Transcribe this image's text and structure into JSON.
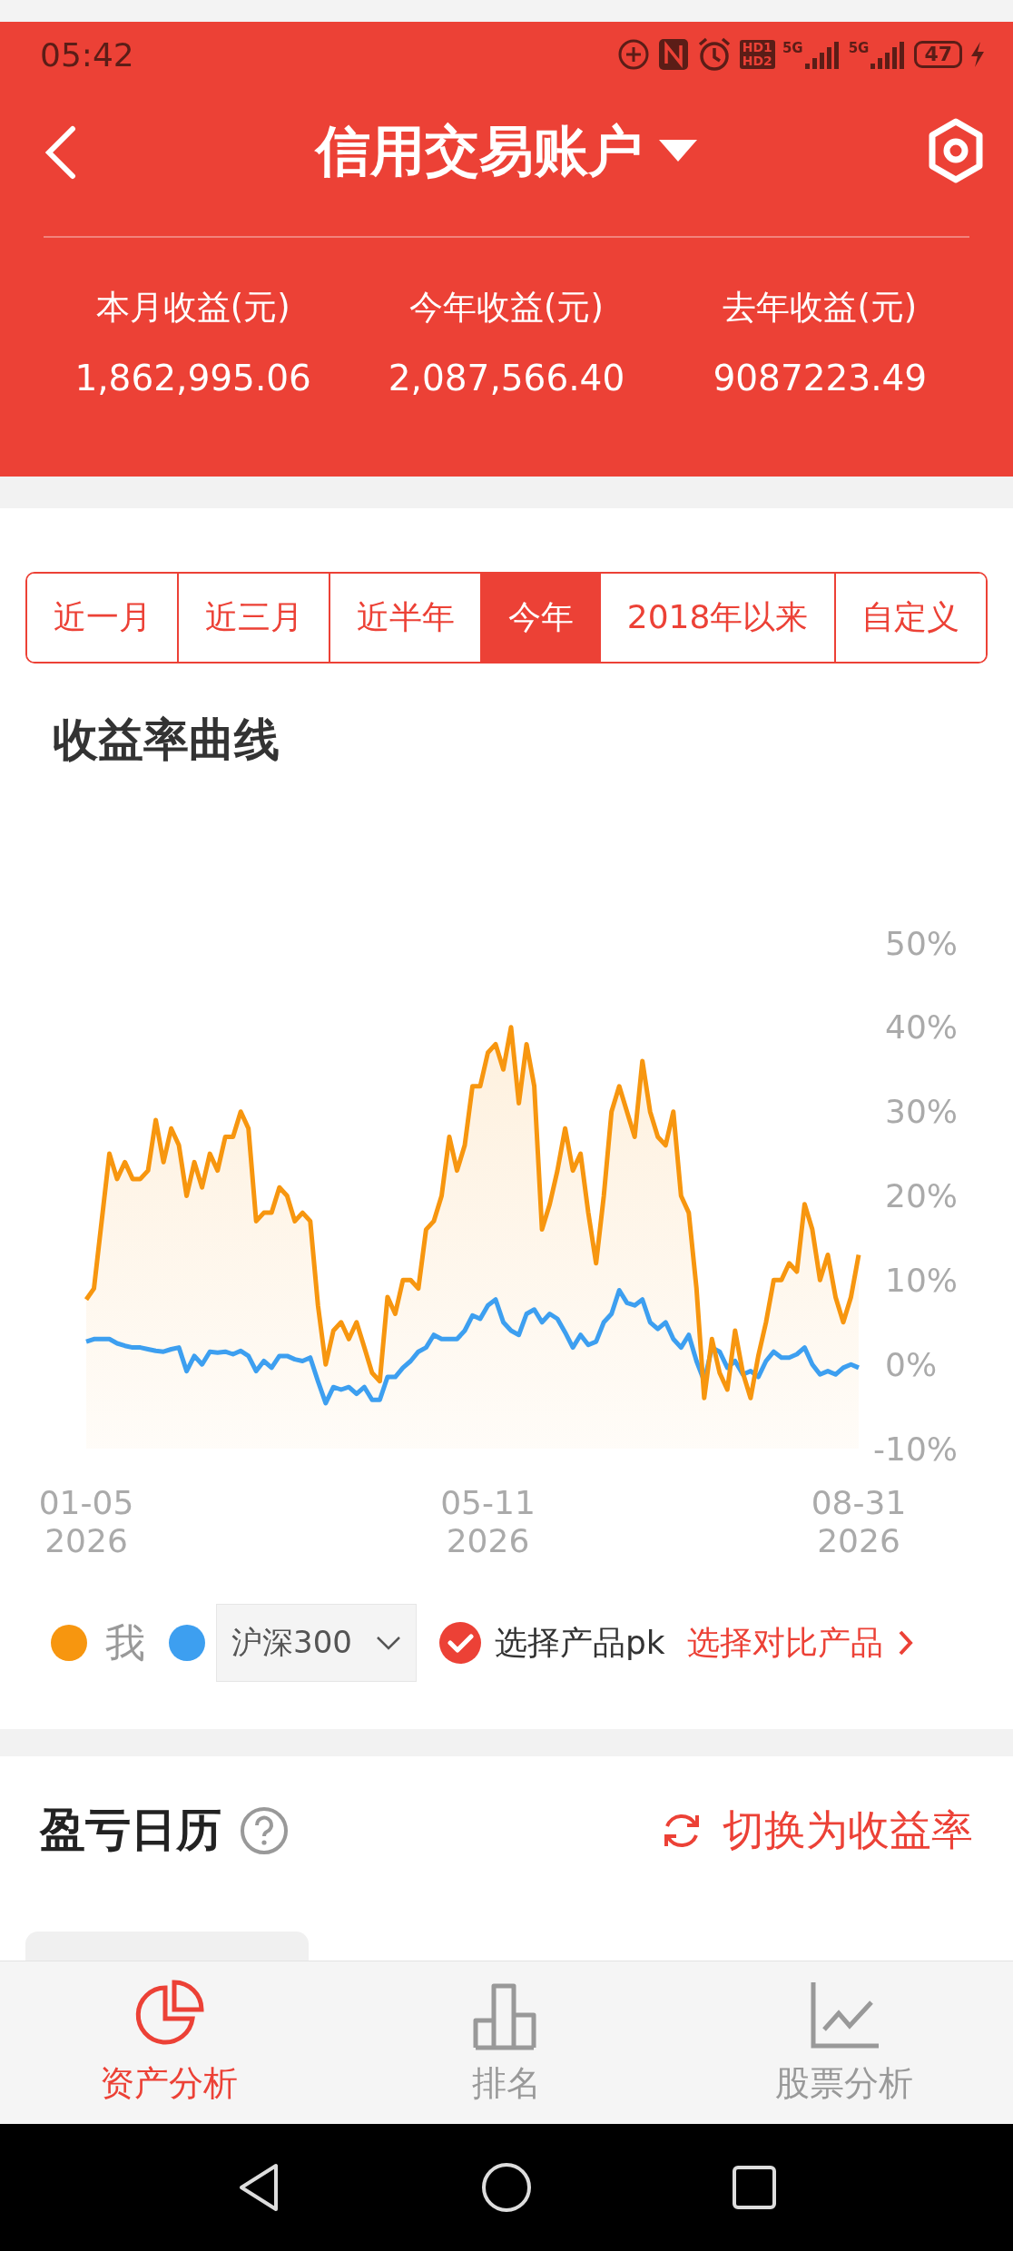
{
  "status_bar": {
    "time": "05:42",
    "hd": [
      "HD1",
      "HD2"
    ],
    "network": [
      "5G",
      "5G"
    ],
    "battery": "47"
  },
  "header": {
    "title": "信用交易账户",
    "stats": [
      {
        "label": "本月收益(元)",
        "value": "1,862,995.06"
      },
      {
        "label": "今年收益(元)",
        "value": "2,087,566.40"
      },
      {
        "label": "去年收益(元)",
        "value": "9087223.49"
      }
    ]
  },
  "period_tabs": [
    {
      "label": "近一月",
      "selected": false
    },
    {
      "label": "近三月",
      "selected": false
    },
    {
      "label": "近半年",
      "selected": false
    },
    {
      "label": "今年",
      "selected": true
    },
    {
      "label": "2018年以来",
      "selected": false
    },
    {
      "label": "自定义",
      "selected": false
    }
  ],
  "return_chart": {
    "title": "收益率曲线",
    "chart_data": {
      "type": "line",
      "categories": [
        "01-05\n2026",
        null,
        null,
        null,
        null,
        null,
        null,
        null,
        null,
        null,
        null,
        null,
        null,
        null,
        null,
        null,
        null,
        null,
        null,
        null,
        null,
        null,
        null,
        null,
        null,
        null,
        null,
        null,
        null,
        null,
        null,
        null,
        null,
        null,
        null,
        null,
        null,
        null,
        null,
        null,
        null,
        null,
        null,
        null,
        null,
        null,
        null,
        null,
        null,
        null,
        null,
        null,
        "05-11\n2026",
        null,
        null,
        null,
        null,
        null,
        null,
        null,
        null,
        null,
        null,
        null,
        null,
        null,
        null,
        null,
        null,
        null,
        null,
        null,
        null,
        null,
        null,
        null,
        null,
        null,
        null,
        null,
        null,
        null,
        null,
        null,
        null,
        null,
        null,
        null,
        null,
        null,
        null,
        null,
        null,
        null,
        null,
        null,
        null,
        null,
        null,
        null,
        "08-31\n2026"
      ],
      "series": [
        {
          "name": "我",
          "color": "#f7960f",
          "values": [
            7.7,
            9,
            17,
            25,
            22,
            24,
            22,
            22,
            23,
            29,
            24,
            28,
            26,
            20,
            24,
            21,
            25,
            23,
            27,
            27,
            30,
            28,
            17,
            18,
            18,
            21,
            20,
            17,
            18,
            17,
            7,
            0,
            4,
            5,
            3,
            5,
            2,
            -1,
            -2,
            8,
            6,
            10,
            10,
            9,
            16,
            17,
            20,
            27,
            23,
            26,
            33,
            33,
            37,
            38,
            35,
            40,
            31,
            38,
            33,
            16,
            19,
            23,
            28,
            23,
            25,
            18,
            12,
            20,
            30,
            33,
            30,
            27,
            36,
            30,
            27,
            26,
            30,
            20,
            18,
            9,
            -4,
            3,
            -1,
            -3,
            4,
            -1,
            -4,
            1,
            5,
            10,
            10,
            12,
            11,
            19,
            16,
            10,
            13,
            8,
            5,
            8,
            13
          ]
        },
        {
          "name": "沪深300",
          "color": "#3d9ff0",
          "values": [
            2.7,
            3,
            3,
            3,
            2.5,
            2.2,
            2,
            2,
            1.8,
            1.6,
            1.5,
            1.8,
            2,
            -0.8,
            1,
            0,
            1.5,
            1.4,
            1.5,
            1.2,
            1.6,
            1,
            -0.8,
            0.4,
            -0.4,
            1,
            1,
            0.6,
            0.4,
            0.8,
            -2,
            -4.6,
            -2.7,
            -3,
            -2.7,
            -3.5,
            -2.7,
            -4.2,
            -4.2,
            -1.5,
            -1.5,
            -0.4,
            0.4,
            1.5,
            2,
            3.5,
            3,
            3,
            3,
            4,
            5.8,
            5.4,
            7,
            7.7,
            5,
            4,
            3.5,
            6,
            6.5,
            5,
            6,
            5.4,
            3.8,
            2,
            3.5,
            2.3,
            2.7,
            5,
            6,
            8.8,
            7.3,
            7,
            7.7,
            5,
            4.2,
            5,
            3,
            2,
            3.5,
            0.4,
            -2,
            2,
            1.5,
            -0.4,
            0.4,
            -1.2,
            -0.8,
            -1.5,
            0.4,
            1.5,
            0.8,
            0.8,
            1.2,
            2,
            0,
            -1.2,
            -0.8,
            -1.2,
            -0.4,
            0,
            -0.4
          ]
        }
      ],
      "ylim": [
        -10,
        50
      ],
      "yticks": [
        {
          "value": 50,
          "label": "50%"
        },
        {
          "value": 40,
          "label": "40%"
        },
        {
          "value": 30,
          "label": "30%"
        },
        {
          "value": 20,
          "label": "20%"
        },
        {
          "value": 10,
          "label": "10%"
        },
        {
          "value": 0,
          "label": "0%"
        },
        {
          "value": -10,
          "label": "-10%"
        }
      ]
    },
    "legend": [
      {
        "kind": "plain"
      },
      {
        "kind": "dropdown"
      }
    ],
    "pk": {
      "label": "选择产品pk",
      "checked": true
    },
    "compare_link": "选择对比产品"
  },
  "calendar": {
    "title": "盈亏日历",
    "switch_link": "切换为收益率"
  },
  "bottom_nav": [
    {
      "label": "资产分析",
      "selected": true
    },
    {
      "label": "排名",
      "selected": false
    },
    {
      "label": "股票分析",
      "selected": false
    }
  ]
}
